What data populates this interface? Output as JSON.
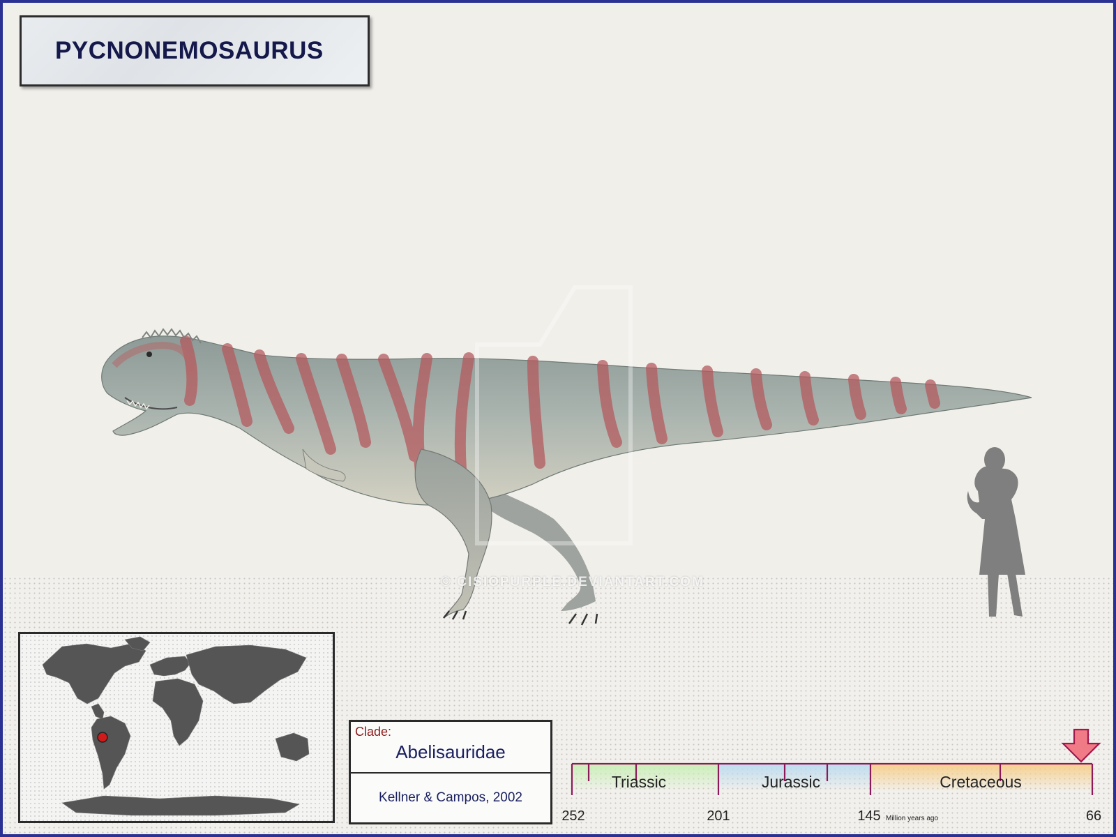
{
  "title": "PYCNONEMOSAURUS",
  "watermark": "© CISIOPURPLE.DEVIANTART.COM",
  "clade": {
    "label": "Clade:",
    "name": "Abelisauridae",
    "authority": "Kellner & Campos, 2002"
  },
  "map": {
    "marker_region": "South America"
  },
  "timeline": {
    "periods": [
      {
        "name": "Triassic",
        "color": "#c9efb7"
      },
      {
        "name": "Jurassic",
        "color": "#bcdcee"
      },
      {
        "name": "Cretaceous",
        "color": "#f6cf8c"
      }
    ],
    "ticks": [
      "252",
      "201",
      "145",
      "66"
    ],
    "unit_label": "Million years ago",
    "marker_color": "#f07a86",
    "line_color": "#8c1a5a"
  },
  "colors": {
    "frame": "#2a3192",
    "title_text": "#14184a",
    "map_marker": "#d11a1a"
  }
}
